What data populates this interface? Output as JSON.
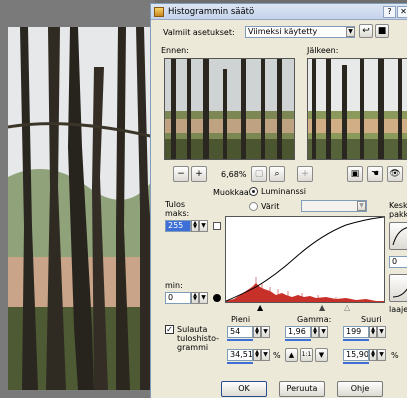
{
  "dialog": {
    "title": "Histogrammin säätö",
    "presets_label": "Valmiit asetukset:",
    "presets_value": "Viimeksi käytetty",
    "before_label": "Ennen:",
    "after_label": "Jälkeen:",
    "zoom_level": "6,68%",
    "modify_label": "Muokkaa:",
    "luminance_label": "Luminanssi",
    "colors_label": "Värit",
    "output_max_label": "Tulos maks:",
    "output_max_value": "255",
    "output_min_label": "min:",
    "output_min_value": "0",
    "mid_label_partial": "Keski pakka",
    "right_field_value": "0",
    "right_lower_label_partial": "laajen",
    "blend_checkbox_label": "Sulauta tuloshisto-grammi",
    "low_label": "Pieni",
    "gamma_label": "Gamma:",
    "high_label": "Suuri",
    "low_value": "54",
    "gamma_value": "1,96",
    "high_value": "199",
    "low_percent": "34,511",
    "high_percent": "15,906",
    "percent_sign": "%",
    "ok_label": "OK",
    "cancel_label": "Peruuta",
    "help_label": "Ohje",
    "one_to_one": "1:1"
  },
  "colors": {
    "accent": "#3d6fd6",
    "dialog_bg": "#ece9d8",
    "histogram_fill": "#c8302a"
  }
}
